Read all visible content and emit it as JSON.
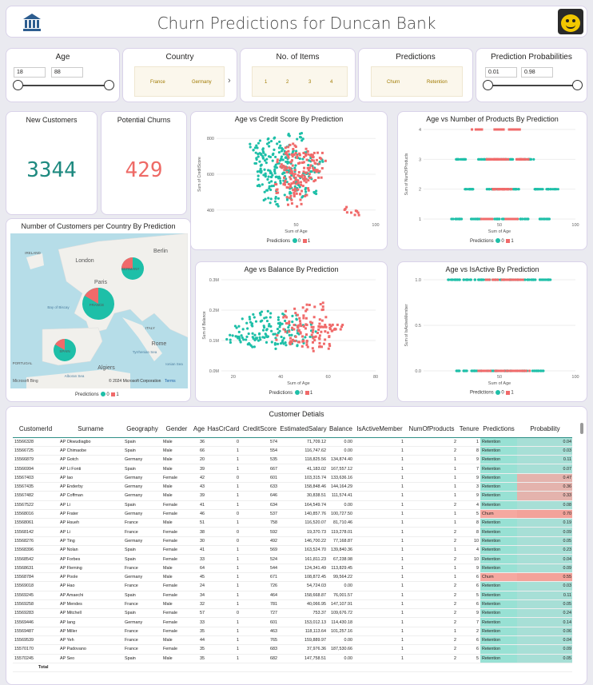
{
  "header": {
    "title": "Churn Predictions for Duncan Bank"
  },
  "filters": {
    "age": {
      "label": "Age",
      "min": "18",
      "max": "88"
    },
    "country": {
      "label": "Country",
      "options": [
        "France",
        "Germany"
      ]
    },
    "items": {
      "label": "No. of Items",
      "options": [
        "1",
        "2",
        "3",
        "4"
      ]
    },
    "predictions": {
      "label": "Predictions",
      "options": [
        "Churn",
        "Retention"
      ]
    },
    "prob": {
      "label": "Prediction Probabilities",
      "min": "0.01",
      "max": "0.98"
    }
  },
  "kpis": {
    "new_label": "New Customers",
    "new_value": "3344",
    "churn_label": "Potential Churns",
    "churn_value": "429"
  },
  "colors": {
    "teal": "#1ebfa8",
    "red": "#f06a6a",
    "header_line": "#2f8f86",
    "kpi_new": "#1f8a80",
    "kpi_churn": "#ee6a66"
  },
  "legend": {
    "label": "Predictions",
    "c0": "0",
    "c1": "1"
  },
  "map": {
    "title": "Number of Customers per Country By Prediction",
    "bing": "Microsoft Bing",
    "copyright": "© 2024 Microsoft Corporation",
    "terms": "Terms",
    "places": [
      {
        "t": "IRELAND"
      },
      {
        "t": "London"
      },
      {
        "t": "Berlin"
      },
      {
        "t": "Paris"
      },
      {
        "t": "Bay of Biscay"
      },
      {
        "t": "FRANCE"
      },
      {
        "t": "GERMANY"
      },
      {
        "t": "ITALY"
      },
      {
        "t": "Rome"
      },
      {
        "t": "Tyrrhenian Sea"
      },
      {
        "t": "Ionian Sea"
      },
      {
        "t": "SPAIN"
      },
      {
        "t": "PORTUGAL"
      },
      {
        "t": "Algiers"
      },
      {
        "t": "Alboran Sea"
      }
    ]
  },
  "chart_data": [
    {
      "type": "scatter",
      "title": "Age vs Credit Score By Prediction",
      "xlabel": "Sum of Age",
      "ylabel": "Sum of CreditScore",
      "xticks": [
        "50",
        "100"
      ],
      "yticks": [
        "800",
        "600",
        "400"
      ],
      "xlim": [
        0,
        100
      ],
      "ylim": [
        350,
        850
      ],
      "series": [
        {
          "name": "0",
          "points": [
            [
              35,
              780
            ],
            [
              40,
              720
            ],
            [
              28,
              690
            ],
            [
              45,
              650
            ],
            [
              33,
              610
            ],
            [
              52,
              700
            ],
            [
              38,
              560
            ],
            [
              30,
              520
            ],
            [
              60,
              630
            ],
            [
              42,
              480
            ],
            [
              25,
              760
            ],
            [
              55,
              580
            ],
            [
              36,
              670
            ],
            [
              48,
              540
            ],
            [
              31,
              600
            ],
            [
              44,
              740
            ],
            [
              58,
              500
            ],
            [
              27,
              640
            ],
            [
              39,
              590
            ],
            [
              50,
              800
            ],
            [
              34,
              450
            ],
            [
              62,
              680
            ],
            [
              46,
              610
            ],
            [
              29,
              720
            ],
            [
              41,
              660
            ]
          ]
        },
        {
          "name": "1",
          "points": [
            [
              48,
              690
            ],
            [
              52,
              600
            ],
            [
              45,
              560
            ],
            [
              55,
              720
            ],
            [
              60,
              640
            ],
            [
              50,
              520
            ],
            [
              43,
              660
            ],
            [
              58,
              580
            ],
            [
              47,
              740
            ],
            [
              53,
              500
            ],
            [
              62,
              610
            ],
            [
              49,
              450
            ],
            [
              56,
              680
            ],
            [
              44,
              620
            ],
            [
              51,
              580
            ],
            [
              85,
              400
            ],
            [
              40,
              520
            ],
            [
              64,
              700
            ]
          ]
        }
      ]
    },
    {
      "type": "scatter",
      "title": "Age vs Number of Products By Prediction",
      "xlabel": "Sum of Age",
      "ylabel": "Sum of NumOfProducts",
      "xticks": [
        "50",
        "100"
      ],
      "yticks": [
        "4",
        "3",
        "2",
        "1"
      ],
      "xlim": [
        0,
        100
      ],
      "ylim": [
        1,
        4
      ],
      "series": [
        {
          "name": "0",
          "points": [
            [
              25,
              3
            ],
            [
              40,
              3
            ],
            [
              55,
              3
            ],
            [
              70,
              3
            ],
            [
              30,
              2
            ],
            [
              45,
              2
            ],
            [
              60,
              2
            ],
            [
              75,
              2
            ],
            [
              85,
              2
            ],
            [
              22,
              1
            ],
            [
              35,
              1
            ],
            [
              50,
              1
            ],
            [
              65,
              1
            ],
            [
              80,
              1
            ]
          ]
        },
        {
          "name": "1",
          "points": [
            [
              35,
              4
            ],
            [
              50,
              4
            ],
            [
              60,
              4
            ],
            [
              45,
              3
            ],
            [
              52,
              3
            ],
            [
              65,
              3
            ],
            [
              48,
              2
            ],
            [
              55,
              2
            ],
            [
              42,
              1
            ],
            [
              58,
              1
            ]
          ]
        }
      ]
    },
    {
      "type": "scatter",
      "title": "Age vs Balance By Prediction",
      "xlabel": "Sum of Age",
      "ylabel": "Sum of Balance",
      "xticks": [
        "20",
        "40",
        "60",
        "80"
      ],
      "yticks": [
        "0.3M",
        "0.2M",
        "0.1M",
        "0.0M"
      ],
      "xlim": [
        15,
        80
      ],
      "ylim": [
        0,
        300000
      ],
      "series": [
        {
          "name": "0",
          "points": [
            [
              25,
              130000
            ],
            [
              30,
              110000
            ],
            [
              35,
              150000
            ],
            [
              40,
              90000
            ],
            [
              28,
              160000
            ],
            [
              33,
              120000
            ],
            [
              45,
              100000
            ],
            [
              38,
              140000
            ],
            [
              42,
              170000
            ],
            [
              50,
              115000
            ],
            [
              27,
              95000
            ],
            [
              36,
              125000
            ],
            [
              31,
              180000
            ],
            [
              48,
              135000
            ],
            [
              22,
              105000
            ]
          ]
        },
        {
          "name": "1",
          "points": [
            [
              45,
              140000
            ],
            [
              50,
              110000
            ],
            [
              55,
              160000
            ],
            [
              48,
              90000
            ],
            [
              52,
              130000
            ],
            [
              58,
              150000
            ],
            [
              46,
              190000
            ],
            [
              60,
              120000
            ],
            [
              43,
              100000
            ],
            [
              53,
              210000
            ],
            [
              56,
              80000
            ],
            [
              62,
              140000
            ],
            [
              47,
              165000
            ]
          ]
        }
      ]
    },
    {
      "type": "scatter",
      "title": "Age vs IsActive By Prediction",
      "xlabel": "Sum of Age",
      "ylabel": "Sum of IsActiveMember",
      "xticks": [
        "50",
        "100"
      ],
      "yticks": [
        "1.0",
        "0.5",
        "0.0"
      ],
      "xlim": [
        0,
        100
      ],
      "ylim": [
        0,
        1
      ],
      "series": [
        {
          "name": "0",
          "points": [
            [
              20,
              1
            ],
            [
              30,
              1
            ],
            [
              40,
              1
            ],
            [
              50,
              1
            ],
            [
              60,
              1
            ],
            [
              70,
              1
            ],
            [
              80,
              1
            ],
            [
              25,
              0
            ],
            [
              35,
              0
            ],
            [
              45,
              0
            ],
            [
              55,
              0
            ],
            [
              65,
              0
            ],
            [
              75,
              0
            ]
          ]
        },
        {
          "name": "1",
          "points": [
            [
              45,
              1
            ],
            [
              55,
              1
            ],
            [
              62,
              1
            ],
            [
              40,
              0
            ],
            [
              50,
              0
            ],
            [
              58,
              0
            ],
            [
              66,
              0
            ]
          ]
        }
      ]
    }
  ],
  "table": {
    "title": "Customer Detials",
    "total": "Total",
    "columns": [
      "CustomerId",
      "Surname",
      "Geography",
      "Gender",
      "Age",
      "HasCrCard",
      "CreditScore",
      "EstimatedSalary",
      "Balance",
      "IsActiveMember",
      "NumOfProducts",
      "Tenure",
      "Predictions",
      "Probability"
    ],
    "rows": [
      [
        "15566328",
        "AP Okwudiagbo",
        "Spain",
        "Male",
        "36",
        "0",
        "574",
        "71,709.12",
        "0.00",
        "1",
        "2",
        "1",
        "Retention",
        "0.04"
      ],
      [
        "15566725",
        "AP Chimaobe",
        "Spain",
        "Male",
        "66",
        "1",
        "554",
        "116,747.62",
        "0.00",
        "1",
        "2",
        "8",
        "Retention",
        "0.03"
      ],
      [
        "15566879",
        "AP Gotch",
        "Germany",
        "Male",
        "20",
        "1",
        "535",
        "118,825.56",
        "134,874.40",
        "1",
        "1",
        "9",
        "Retention",
        "0.11"
      ],
      [
        "15566994",
        "AP Li Fonti",
        "Spain",
        "Male",
        "39",
        "1",
        "667",
        "41,183.02",
        "167,557.12",
        "1",
        "1",
        "7",
        "Retention",
        "0.07"
      ],
      [
        "15567403",
        "AP Iao",
        "Germany",
        "Female",
        "42",
        "0",
        "601",
        "103,315.74",
        "133,636.16",
        "1",
        "1",
        "9",
        "Retention",
        "0.47"
      ],
      [
        "15567435",
        "AP Enderby",
        "Germany",
        "Male",
        "43",
        "1",
        "633",
        "158,848.46",
        "144,164.29",
        "1",
        "1",
        "3",
        "Retention",
        "0.36"
      ],
      [
        "15567482",
        "AP Coffman",
        "Germany",
        "Male",
        "39",
        "1",
        "646",
        "30,838.51",
        "111,574.41",
        "1",
        "1",
        "9",
        "Retention",
        "0.33"
      ],
      [
        "15567522",
        "AP Li",
        "Spain",
        "Female",
        "41",
        "1",
        "634",
        "164,549.74",
        "0.00",
        "1",
        "2",
        "4",
        "Retention",
        "0.08"
      ],
      [
        "15568016",
        "AP Frater",
        "Germany",
        "Female",
        "46",
        "0",
        "537",
        "140,857.76",
        "100,727.50",
        "1",
        "1",
        "5",
        "Churn",
        "0.70"
      ],
      [
        "15568061",
        "AP Hsueh",
        "France",
        "Male",
        "51",
        "1",
        "758",
        "116,520.07",
        "81,710.46",
        "1",
        "1",
        "8",
        "Retention",
        "0.19"
      ],
      [
        "15568142",
        "AP Li",
        "France",
        "Female",
        "38",
        "0",
        "592",
        "19,370.73",
        "119,278.01",
        "1",
        "2",
        "8",
        "Retention",
        "0.09"
      ],
      [
        "15568276",
        "AP Ting",
        "Germany",
        "Female",
        "30",
        "0",
        "492",
        "146,700.22",
        "77,168.87",
        "1",
        "2",
        "10",
        "Retention",
        "0.05"
      ],
      [
        "15568396",
        "AP Nolan",
        "Spain",
        "Female",
        "41",
        "1",
        "569",
        "163,524.70",
        "139,840.36",
        "1",
        "1",
        "4",
        "Retention",
        "0.23"
      ],
      [
        "15568542",
        "AP Forbes",
        "Spain",
        "Female",
        "33",
        "1",
        "524",
        "161,811.23",
        "67,238.98",
        "1",
        "2",
        "10",
        "Retention",
        "0.04"
      ],
      [
        "15568631",
        "AP Fleming",
        "France",
        "Male",
        "64",
        "1",
        "544",
        "124,341.49",
        "113,829.45",
        "1",
        "1",
        "9",
        "Retention",
        "0.09"
      ],
      [
        "15568784",
        "AP Poole",
        "Germany",
        "Male",
        "45",
        "1",
        "671",
        "108,872.45",
        "99,564.22",
        "1",
        "1",
        "6",
        "Churn",
        "0.55"
      ],
      [
        "15569018",
        "AP Hao",
        "France",
        "Female",
        "24",
        "1",
        "726",
        "54,724.03",
        "0.00",
        "1",
        "2",
        "6",
        "Retention",
        "0.03"
      ],
      [
        "15569245",
        "AP Amaechi",
        "Spain",
        "Female",
        "34",
        "1",
        "464",
        "158,668.87",
        "76,001.57",
        "1",
        "2",
        "5",
        "Retention",
        "0.11"
      ],
      [
        "15569258",
        "AP Mendes",
        "France",
        "Male",
        "32",
        "1",
        "781",
        "40,066.95",
        "147,107.91",
        "1",
        "2",
        "6",
        "Retention",
        "0.05"
      ],
      [
        "15569283",
        "AP Mitchell",
        "Spain",
        "Female",
        "57",
        "0",
        "727",
        "753.37",
        "109,676.72",
        "1",
        "2",
        "9",
        "Retention",
        "0.24"
      ],
      [
        "15569446",
        "AP Iang",
        "Germany",
        "Female",
        "33",
        "1",
        "601",
        "153,012.13",
        "114,430.18",
        "1",
        "2",
        "7",
        "Retention",
        "0.14"
      ],
      [
        "15569487",
        "AP Miller",
        "France",
        "Female",
        "35",
        "1",
        "463",
        "118,113.64",
        "101,257.16",
        "1",
        "1",
        "2",
        "Retention",
        "0.06"
      ],
      [
        "15569539",
        "AP Yeh",
        "France",
        "Male",
        "44",
        "1",
        "765",
        "159,889.97",
        "0.00",
        "1",
        "2",
        "6",
        "Retention",
        "0.04"
      ],
      [
        "15570170",
        "AP Padovano",
        "France",
        "Female",
        "35",
        "1",
        "683",
        "37,976.36",
        "187,530.66",
        "1",
        "2",
        "6",
        "Retention",
        "0.09"
      ],
      [
        "15570245",
        "AP Seo",
        "Spain",
        "Male",
        "35",
        "1",
        "682",
        "147,758.51",
        "0.00",
        "1",
        "2",
        "5",
        "Retention",
        "0.05"
      ]
    ]
  }
}
